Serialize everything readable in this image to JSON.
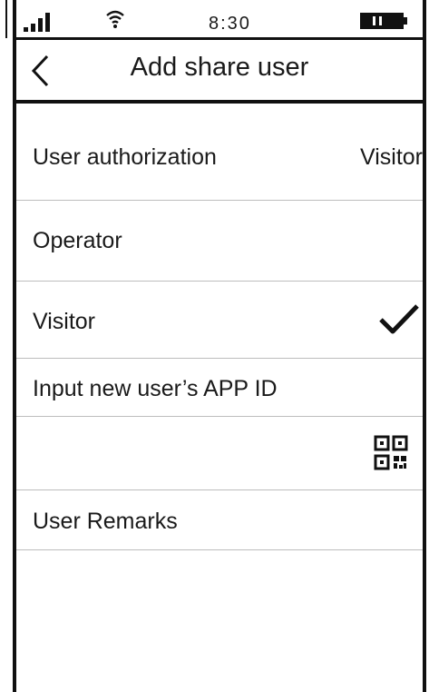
{
  "status_bar": {
    "time": "8:30"
  },
  "header": {
    "title": "Add share user"
  },
  "rows": {
    "authorization": {
      "label": "User authorization",
      "value": "Visitor"
    },
    "operator": {
      "label": "Operator"
    },
    "visitor": {
      "label": "Visitor",
      "selected": true
    },
    "app_id": {
      "label": "Input new user’s APP ID"
    },
    "remarks": {
      "label": "User Remarks"
    }
  },
  "icons": {
    "signal": "signal-icon",
    "wifi": "wifi-icon",
    "battery": "battery-icon",
    "back": "chevron-left-icon",
    "check": "checkmark-icon",
    "qr": "qr-code-icon"
  }
}
